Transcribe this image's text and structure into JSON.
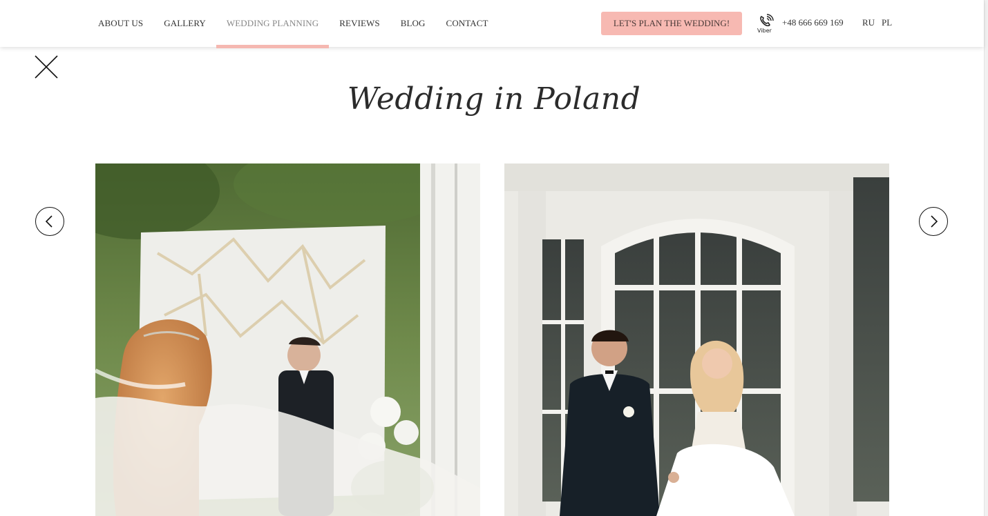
{
  "nav": {
    "items": [
      {
        "label": "ABOUT US"
      },
      {
        "label": "GALLERY"
      },
      {
        "label": "WEDDING PLANNING"
      },
      {
        "label": "REVIEWS"
      },
      {
        "label": "BLOG"
      },
      {
        "label": "CONTACT"
      }
    ],
    "active_index": 2
  },
  "header": {
    "cta_label": "LET'S PLAN THE WEDDING!",
    "viber_label": "Viber",
    "phone": "+48 666 669 169",
    "languages": [
      "RU",
      "PL"
    ]
  },
  "gallery": {
    "title": "Wedding in Poland",
    "photos": [
      {
        "alt": "Bride with long veil walking toward groom near white geometric backdrop"
      },
      {
        "alt": "Couple walking hand in hand in front of white palace windows"
      }
    ]
  },
  "colors": {
    "accent": "#f7b9b2",
    "nav_active_underline": "#f5b8b1"
  },
  "icons": {
    "close": "close-icon",
    "prev": "chevron-left-icon",
    "next": "chevron-right-icon",
    "viber": "viber-icon"
  }
}
